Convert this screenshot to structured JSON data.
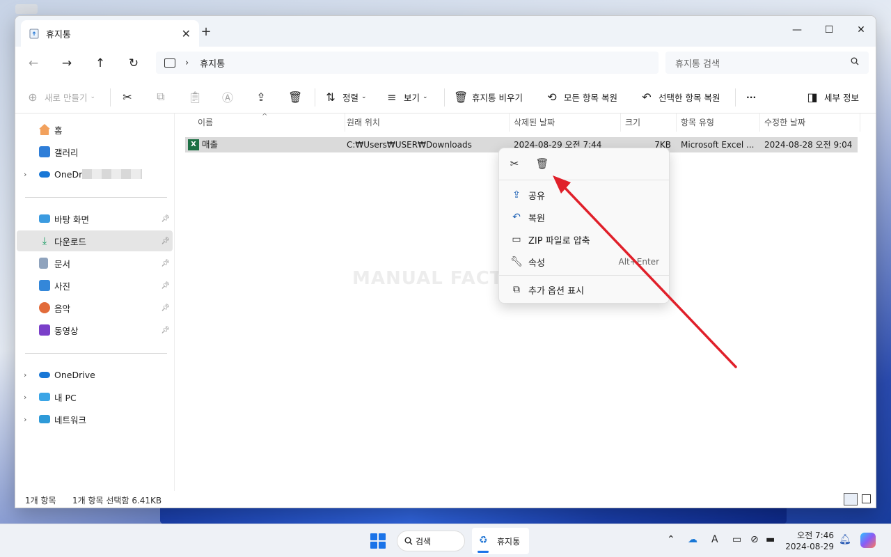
{
  "window": {
    "tab_title": "휴지통",
    "new_tab_label": "+",
    "close_tab_label": "✕",
    "minimize_label": "—",
    "maximize_label": "☐",
    "close_label": "✕"
  },
  "navbar": {
    "back_icon": "←",
    "forward_icon": "→",
    "up_icon": "↑",
    "refresh_icon": "↻",
    "breadcrumb_separator": "›",
    "breadcrumb": "휴지통",
    "search_placeholder": "휴지통 검색"
  },
  "toolbar": {
    "new_label": "새로 만들기",
    "sort_label": "정렬",
    "view_label": "보기",
    "empty_label": "휴지통 비우기",
    "restore_all_label": "모든 항목 복원",
    "restore_selected_label": "선택한 항목 복원",
    "more_label": "···",
    "details_label": "세부 정보"
  },
  "sidebar": {
    "items": [
      {
        "label": "홈",
        "icon": "home-icon"
      },
      {
        "label": "갤러리",
        "icon": "gallery-icon"
      },
      {
        "label": "OneDriv",
        "icon": "onedrive-icon"
      },
      {
        "label": "바탕 화면",
        "icon": "desktop-icon"
      },
      {
        "label": "다운로드",
        "icon": "download-icon"
      },
      {
        "label": "문서",
        "icon": "documents-icon"
      },
      {
        "label": "사진",
        "icon": "pictures-icon"
      },
      {
        "label": "음악",
        "icon": "music-icon"
      },
      {
        "label": "동영상",
        "icon": "videos-icon"
      },
      {
        "label": "OneDrive",
        "icon": "onedrive-icon"
      },
      {
        "label": "내 PC",
        "icon": "pc-icon"
      },
      {
        "label": "네트워크",
        "icon": "network-icon"
      }
    ]
  },
  "columns": [
    "이름",
    "원래 위치",
    "삭제된 날짜",
    "크기",
    "항목 유형",
    "수정한 날짜"
  ],
  "files": [
    {
      "name": "매출",
      "original_location": "C:₩Users₩USER₩Downloads",
      "deleted_date": "2024-08-29 오전 7:44",
      "size": "7KB",
      "type": "Microsoft Excel ...",
      "modified_date": "2024-08-28 오전 9:04"
    }
  ],
  "watermark": "MANUAL FACTORY",
  "status": {
    "count": "1개 항목",
    "selected": "1개 항목 선택함 6.41KB"
  },
  "context_menu": {
    "items": [
      {
        "label": "공유",
        "shortcut": ""
      },
      {
        "label": "복원",
        "shortcut": ""
      },
      {
        "label": "ZIP 파일로 압축",
        "shortcut": ""
      },
      {
        "label": "속성",
        "shortcut": "Alt+Enter"
      },
      {
        "label": "추가 옵션 표시",
        "shortcut": ""
      }
    ]
  },
  "taskbar": {
    "search_label": "검색",
    "app_label": "휴지통",
    "time": "오전 7:46",
    "date": "2024-08-29"
  },
  "colors": {
    "accent": "#1a73e8",
    "selection": "#dadada",
    "arrow": "#e0202a"
  }
}
